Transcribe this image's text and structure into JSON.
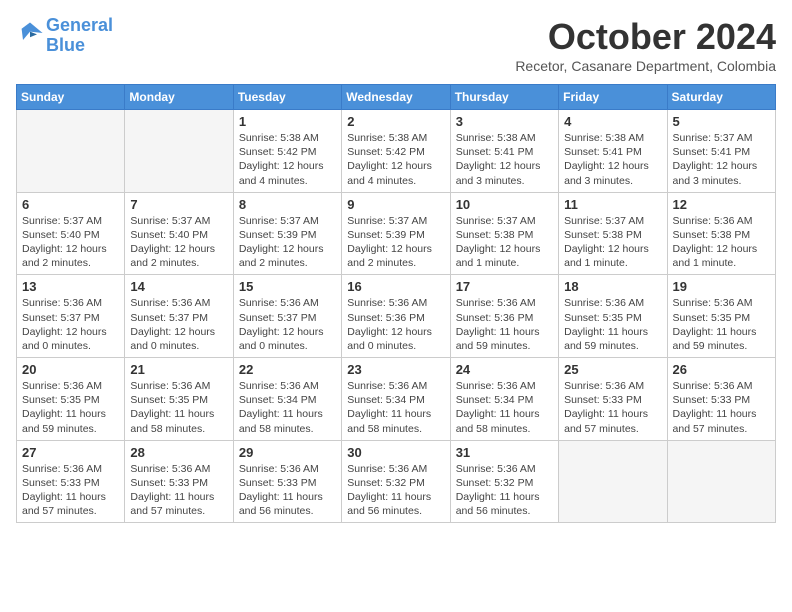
{
  "header": {
    "logo_line1": "General",
    "logo_line2": "Blue",
    "month_title": "October 2024",
    "subtitle": "Recetor, Casanare Department, Colombia"
  },
  "days_of_week": [
    "Sunday",
    "Monday",
    "Tuesday",
    "Wednesday",
    "Thursday",
    "Friday",
    "Saturday"
  ],
  "weeks": [
    [
      {
        "day": null,
        "info": null
      },
      {
        "day": null,
        "info": null
      },
      {
        "day": "1",
        "info": "Sunrise: 5:38 AM\nSunset: 5:42 PM\nDaylight: 12 hours\nand 4 minutes."
      },
      {
        "day": "2",
        "info": "Sunrise: 5:38 AM\nSunset: 5:42 PM\nDaylight: 12 hours\nand 4 minutes."
      },
      {
        "day": "3",
        "info": "Sunrise: 5:38 AM\nSunset: 5:41 PM\nDaylight: 12 hours\nand 3 minutes."
      },
      {
        "day": "4",
        "info": "Sunrise: 5:38 AM\nSunset: 5:41 PM\nDaylight: 12 hours\nand 3 minutes."
      },
      {
        "day": "5",
        "info": "Sunrise: 5:37 AM\nSunset: 5:41 PM\nDaylight: 12 hours\nand 3 minutes."
      }
    ],
    [
      {
        "day": "6",
        "info": "Sunrise: 5:37 AM\nSunset: 5:40 PM\nDaylight: 12 hours\nand 2 minutes."
      },
      {
        "day": "7",
        "info": "Sunrise: 5:37 AM\nSunset: 5:40 PM\nDaylight: 12 hours\nand 2 minutes."
      },
      {
        "day": "8",
        "info": "Sunrise: 5:37 AM\nSunset: 5:39 PM\nDaylight: 12 hours\nand 2 minutes."
      },
      {
        "day": "9",
        "info": "Sunrise: 5:37 AM\nSunset: 5:39 PM\nDaylight: 12 hours\nand 2 minutes."
      },
      {
        "day": "10",
        "info": "Sunrise: 5:37 AM\nSunset: 5:38 PM\nDaylight: 12 hours\nand 1 minute."
      },
      {
        "day": "11",
        "info": "Sunrise: 5:37 AM\nSunset: 5:38 PM\nDaylight: 12 hours\nand 1 minute."
      },
      {
        "day": "12",
        "info": "Sunrise: 5:36 AM\nSunset: 5:38 PM\nDaylight: 12 hours\nand 1 minute."
      }
    ],
    [
      {
        "day": "13",
        "info": "Sunrise: 5:36 AM\nSunset: 5:37 PM\nDaylight: 12 hours\nand 0 minutes."
      },
      {
        "day": "14",
        "info": "Sunrise: 5:36 AM\nSunset: 5:37 PM\nDaylight: 12 hours\nand 0 minutes."
      },
      {
        "day": "15",
        "info": "Sunrise: 5:36 AM\nSunset: 5:37 PM\nDaylight: 12 hours\nand 0 minutes."
      },
      {
        "day": "16",
        "info": "Sunrise: 5:36 AM\nSunset: 5:36 PM\nDaylight: 12 hours\nand 0 minutes."
      },
      {
        "day": "17",
        "info": "Sunrise: 5:36 AM\nSunset: 5:36 PM\nDaylight: 11 hours\nand 59 minutes."
      },
      {
        "day": "18",
        "info": "Sunrise: 5:36 AM\nSunset: 5:35 PM\nDaylight: 11 hours\nand 59 minutes."
      },
      {
        "day": "19",
        "info": "Sunrise: 5:36 AM\nSunset: 5:35 PM\nDaylight: 11 hours\nand 59 minutes."
      }
    ],
    [
      {
        "day": "20",
        "info": "Sunrise: 5:36 AM\nSunset: 5:35 PM\nDaylight: 11 hours\nand 59 minutes."
      },
      {
        "day": "21",
        "info": "Sunrise: 5:36 AM\nSunset: 5:35 PM\nDaylight: 11 hours\nand 58 minutes."
      },
      {
        "day": "22",
        "info": "Sunrise: 5:36 AM\nSunset: 5:34 PM\nDaylight: 11 hours\nand 58 minutes."
      },
      {
        "day": "23",
        "info": "Sunrise: 5:36 AM\nSunset: 5:34 PM\nDaylight: 11 hours\nand 58 minutes."
      },
      {
        "day": "24",
        "info": "Sunrise: 5:36 AM\nSunset: 5:34 PM\nDaylight: 11 hours\nand 58 minutes."
      },
      {
        "day": "25",
        "info": "Sunrise: 5:36 AM\nSunset: 5:33 PM\nDaylight: 11 hours\nand 57 minutes."
      },
      {
        "day": "26",
        "info": "Sunrise: 5:36 AM\nSunset: 5:33 PM\nDaylight: 11 hours\nand 57 minutes."
      }
    ],
    [
      {
        "day": "27",
        "info": "Sunrise: 5:36 AM\nSunset: 5:33 PM\nDaylight: 11 hours\nand 57 minutes."
      },
      {
        "day": "28",
        "info": "Sunrise: 5:36 AM\nSunset: 5:33 PM\nDaylight: 11 hours\nand 57 minutes."
      },
      {
        "day": "29",
        "info": "Sunrise: 5:36 AM\nSunset: 5:33 PM\nDaylight: 11 hours\nand 56 minutes."
      },
      {
        "day": "30",
        "info": "Sunrise: 5:36 AM\nSunset: 5:32 PM\nDaylight: 11 hours\nand 56 minutes."
      },
      {
        "day": "31",
        "info": "Sunrise: 5:36 AM\nSunset: 5:32 PM\nDaylight: 11 hours\nand 56 minutes."
      },
      {
        "day": null,
        "info": null
      },
      {
        "day": null,
        "info": null
      }
    ]
  ]
}
